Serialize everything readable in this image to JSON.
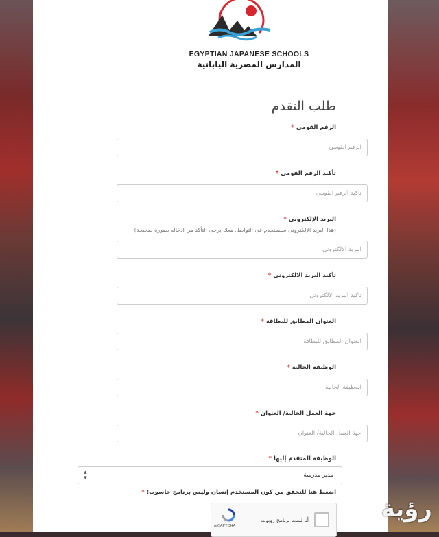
{
  "logo": {
    "name_en": "EGYPTIAN JAPANESE SCHOOLS",
    "name_ar": "المدارس المصرية اليابانية"
  },
  "form": {
    "title": "طلب التقدم",
    "required_marker": "*",
    "fields": {
      "national_id": {
        "label": "الرقم القومى",
        "placeholder": "الرقم القومى"
      },
      "national_id_confirm": {
        "label": "تأكيد الرقم القومى",
        "placeholder": "تأكيد الرقم القومى"
      },
      "email": {
        "label": "البريد الإلكترونى",
        "hint": "(هذا البريد الإلكترونى سيستخدم فى التواصل معك يرجى التأكد من ادخاله بصورة صحيحة)",
        "placeholder": "البريد الإلكترونى"
      },
      "email_confirm": {
        "label": "تأكيد البريد الالكترونى",
        "placeholder": "تأكيد البريد الالكترونى"
      },
      "address": {
        "label": "العنوان المطابق للبطاقة",
        "placeholder": "العنوان المطابق للبطاقة"
      },
      "current_job": {
        "label": "الوظيفة الحالية",
        "placeholder": "الوظيفة الحالية"
      },
      "workplace": {
        "label": "جهة العمل الحالية/ العنوان",
        "placeholder": "جهة العمل الحالية/ العنوان"
      },
      "applied_job": {
        "label": "الوظيفة المتقدم إليها",
        "selected": "مدير مدرسة"
      }
    },
    "captcha": {
      "label": "اضغط هنا للتحقق من كون المستخدم إنسان وليس برنامج حاسوب:",
      "checkbox_text": "أنا لست برنامج روبوت",
      "brand": "reCAPTCHA"
    }
  },
  "watermark": "رؤية",
  "colors": {
    "accent": "#d9262e",
    "required": "#dd3333",
    "logo_wave": "#3aa0d6"
  }
}
